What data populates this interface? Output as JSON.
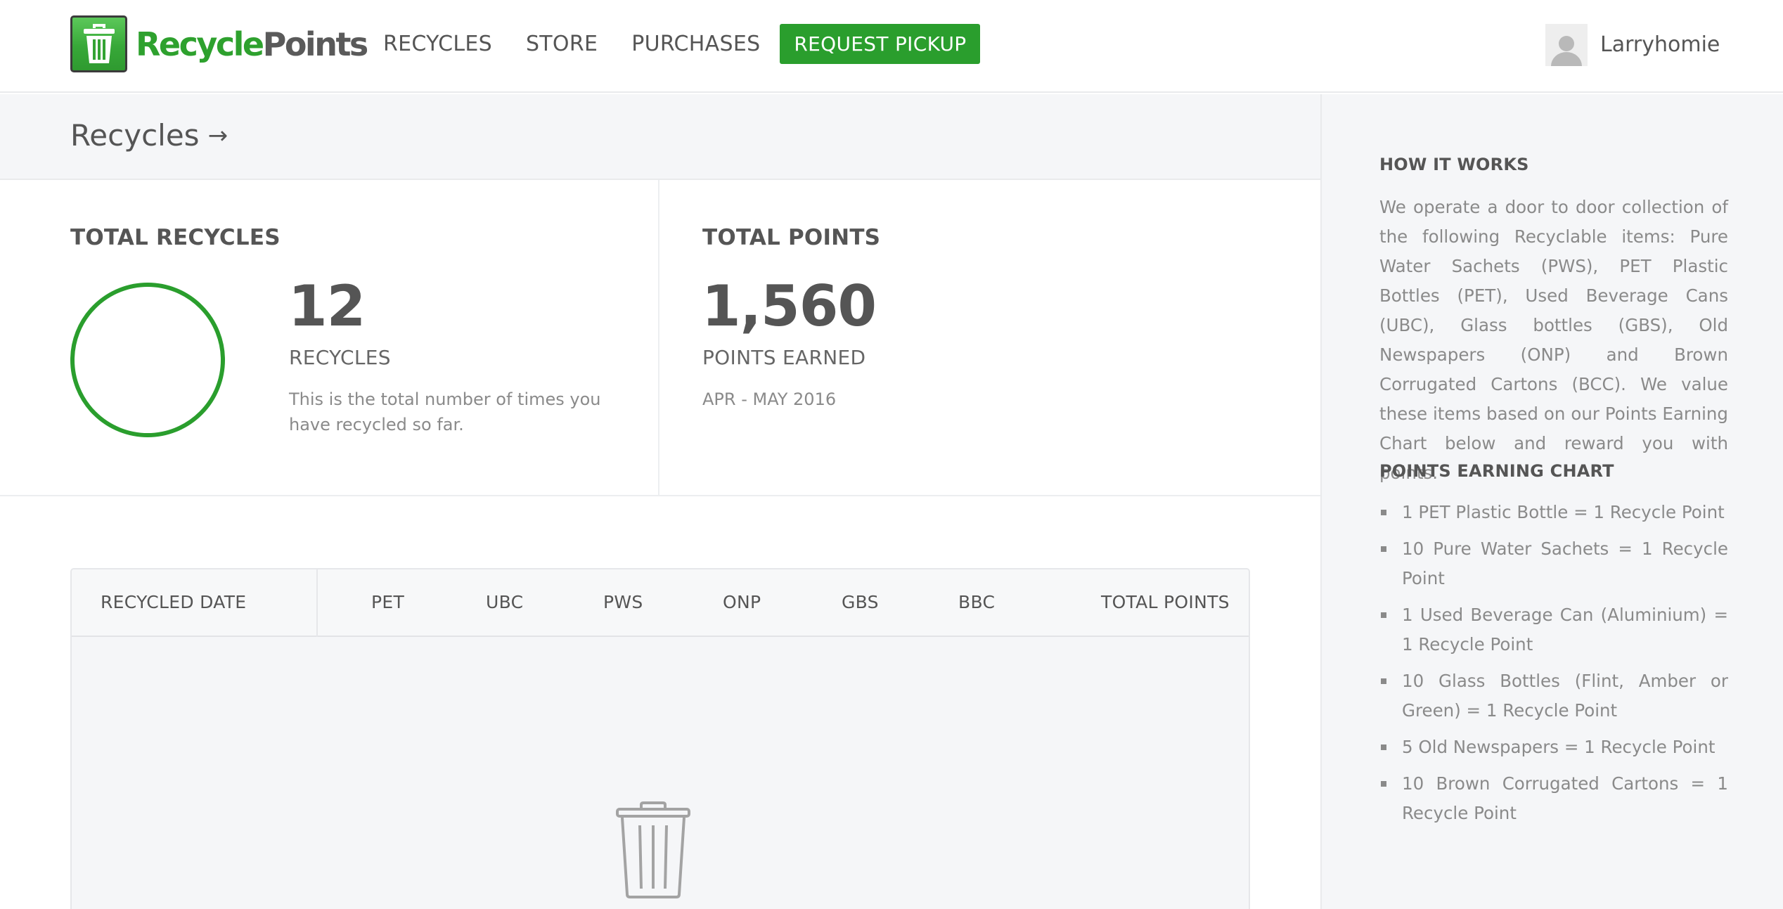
{
  "brand": {
    "name_green": "Recycle",
    "name_dark": "Points",
    "icon": "trash-can-icon",
    "accent_color": "#2a9e2d"
  },
  "nav": {
    "recycles": "RECYCLES",
    "store": "STORE",
    "purchases": "PURCHASES",
    "request_pickup": "REQUEST PICKUP"
  },
  "user": {
    "name": "Larryhomie",
    "avatar": "default-avatar-icon"
  },
  "page": {
    "title": "Recycles",
    "title_icon": "arrow-right-icon"
  },
  "stats": {
    "recycles": {
      "heading": "TOTAL RECYCLES",
      "value": "12",
      "label": "RECYCLES",
      "description": "This is the total number of times you have recycled so far."
    },
    "points": {
      "heading": "TOTAL POINTS",
      "value": "1,560",
      "label": "POINTS EARNED",
      "period": "APR - MAY 2016"
    }
  },
  "table": {
    "columns": [
      "RECYCLED DATE",
      "PET",
      "UBC",
      "PWS",
      "ONP",
      "GBS",
      "BBC",
      "TOTAL POINTS"
    ],
    "rows": [],
    "empty_icon": "trash-can-icon"
  },
  "sidebar": {
    "how_heading": "HOW IT WORKS",
    "how_text": "We operate a door to door collection of the following Recyclable items: Pure Water Sachets (PWS), PET Plastic Bottles (PET), Used Beverage Cans (UBC), Glass bottles (GBS), Old Newspapers (ONP) and Brown Corrugated Cartons (BCC). We value these items based on our Points Earning Chart below and reward you with points.",
    "chart_heading": "POINTS EARNING CHART",
    "chart_items": [
      "1 PET Plastic Bottle = 1 Recycle Point",
      "10 Pure Water Sachets = 1 Recycle Point",
      "1 Used Beverage Can (Aluminium) = 1 Recycle Point",
      "10 Glass Bottles (Flint, Amber or Green) = 1 Recycle Point",
      "5 Old Newspapers = 1 Recycle Point",
      "10 Brown Corrugated Cartons = 1 Recycle Point"
    ]
  }
}
